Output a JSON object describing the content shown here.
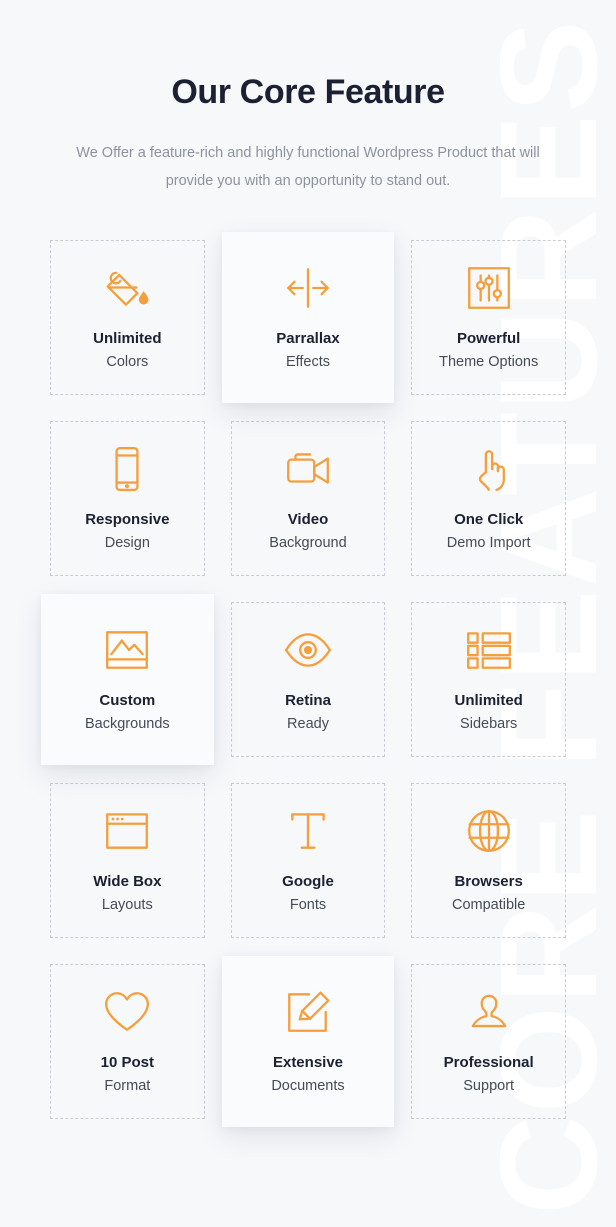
{
  "watermark": {
    "text": "CORE FEATURES",
    "color": "#FFFFFF"
  },
  "theme": {
    "accent": "#F59E3C",
    "background": "#F6F8FA",
    "title_color": "#1B2132",
    "subtitle_color": "#8D939E",
    "card_border_color": "#C9CED6",
    "active_card_background": "#FAFBFC"
  },
  "header": {
    "title": "Our Core Feature",
    "subtitle": "We Offer a feature-rich and highly functional Wordpress Product that will provide you with an opportunity to stand out."
  },
  "features": [
    {
      "icon": "paint-bucket-icon",
      "title": "Unlimited",
      "subtitle": "Colors",
      "active": false
    },
    {
      "icon": "parallax-arrows-icon",
      "title": "Parrallax",
      "subtitle": "Effects",
      "active": true
    },
    {
      "icon": "sliders-icon",
      "title": "Powerful",
      "subtitle": "Theme Options",
      "active": false
    },
    {
      "icon": "mobile-phone-icon",
      "title": "Responsive",
      "subtitle": "Design",
      "active": false
    },
    {
      "icon": "video-camera-icon",
      "title": "Video",
      "subtitle": "Background",
      "active": false
    },
    {
      "icon": "pointing-hand-icon",
      "title": "One Click",
      "subtitle": "Demo Import",
      "active": false
    },
    {
      "icon": "image-picture-icon",
      "title": "Custom",
      "subtitle": "Backgrounds",
      "active": true
    },
    {
      "icon": "eye-icon",
      "title": "Retina",
      "subtitle": "Ready",
      "active": false
    },
    {
      "icon": "sidebar-list-icon",
      "title": "Unlimited",
      "subtitle": "Sidebars",
      "active": false
    },
    {
      "icon": "browser-window-icon",
      "title": "Wide Box",
      "subtitle": "Layouts",
      "active": false
    },
    {
      "icon": "text-type-icon",
      "title": "Google",
      "subtitle": "Fonts",
      "active": false
    },
    {
      "icon": "globe-icon",
      "title": "Browsers",
      "subtitle": "Compatible",
      "active": false
    },
    {
      "icon": "heart-icon",
      "title": "10 Post",
      "subtitle": "Format",
      "active": false
    },
    {
      "icon": "pencil-edit-icon",
      "title": "Extensive",
      "subtitle": "Documents",
      "active": true
    },
    {
      "icon": "user-person-icon",
      "title": "Professional",
      "subtitle": "Support",
      "active": false
    }
  ]
}
